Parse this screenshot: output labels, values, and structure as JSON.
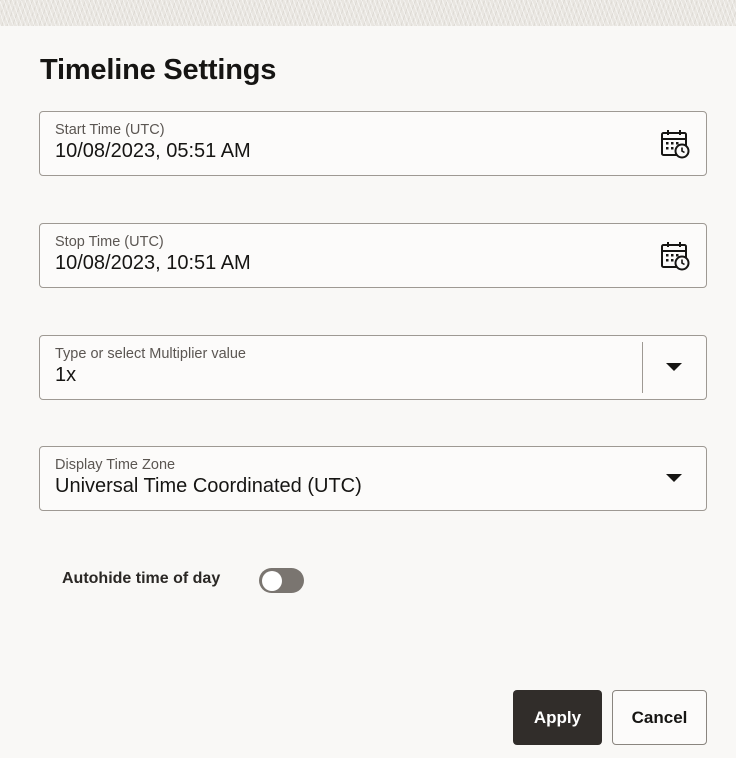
{
  "dialog": {
    "title": "Timeline Settings"
  },
  "fields": {
    "start_time": {
      "label": "Start Time (UTC)",
      "value": "10/08/2023, 05:51 AM",
      "icon": "calendar-clock-icon"
    },
    "stop_time": {
      "label": "Stop Time (UTC)",
      "value": "10/08/2023, 10:51 AM",
      "icon": "calendar-clock-icon"
    },
    "multiplier": {
      "label": "Type or select Multiplier value",
      "value": "1x",
      "icon": "chevron-down-icon"
    },
    "time_zone": {
      "label": "Display Time Zone",
      "value": "Universal Time Coordinated (UTC)",
      "icon": "chevron-down-icon"
    }
  },
  "autohide": {
    "label": "Autohide time of day",
    "enabled": false
  },
  "buttons": {
    "apply": "Apply",
    "cancel": "Cancel"
  },
  "colors": {
    "background": "#f9f8f6",
    "primary_button": "#312d2a",
    "toggle_off": "#7a7570",
    "border": "#9e9993"
  }
}
